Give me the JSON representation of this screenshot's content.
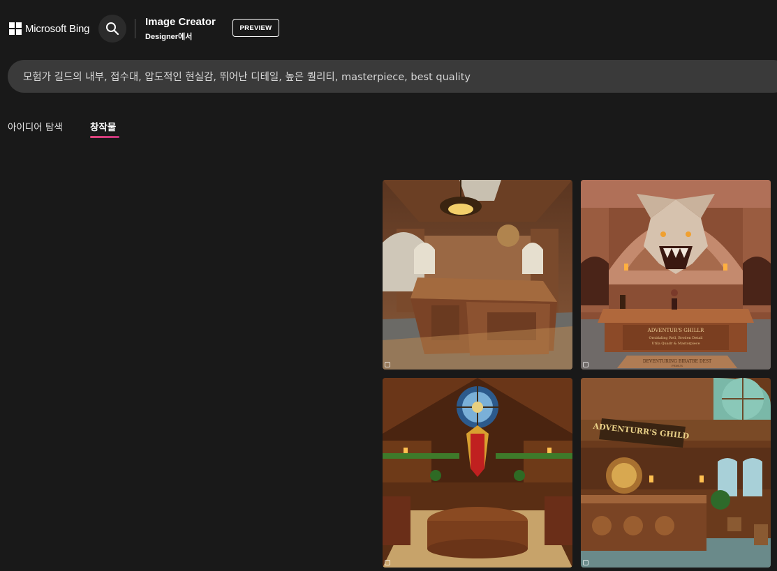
{
  "header": {
    "brand": "Microsoft Bing",
    "app_title": "Image Creator",
    "app_subtitle": "Designer에서",
    "badge": "PREVIEW"
  },
  "prompt": {
    "text": "모험가 길드의 내부, 접수대, 압도적인 현실감, 뛰어난 디테일, 높은 퀄리티, masterpiece, best quality"
  },
  "tabs": [
    {
      "label": "아이디어 탐색",
      "active": false
    },
    {
      "label": "창작물",
      "active": true
    }
  ],
  "images": [
    {
      "sign_lines": []
    },
    {
      "sign_lines": [
        "ADVENTUR'S GHILLR",
        "Ornidaling Rell, Broden Detail",
        "Utila Quadr & Mastorpiece"
      ],
      "mat_lines": [
        "DEVENTURING BIRATBE DEST",
        "FEMUS"
      ]
    },
    {
      "sign_lines": []
    },
    {
      "sign_lines": [
        "ADVENTURR'S GHILD"
      ]
    }
  ],
  "colors": {
    "background": "#191919",
    "prompt_bar": "#3a3a3a",
    "tab_indicator": "#e0457b"
  }
}
